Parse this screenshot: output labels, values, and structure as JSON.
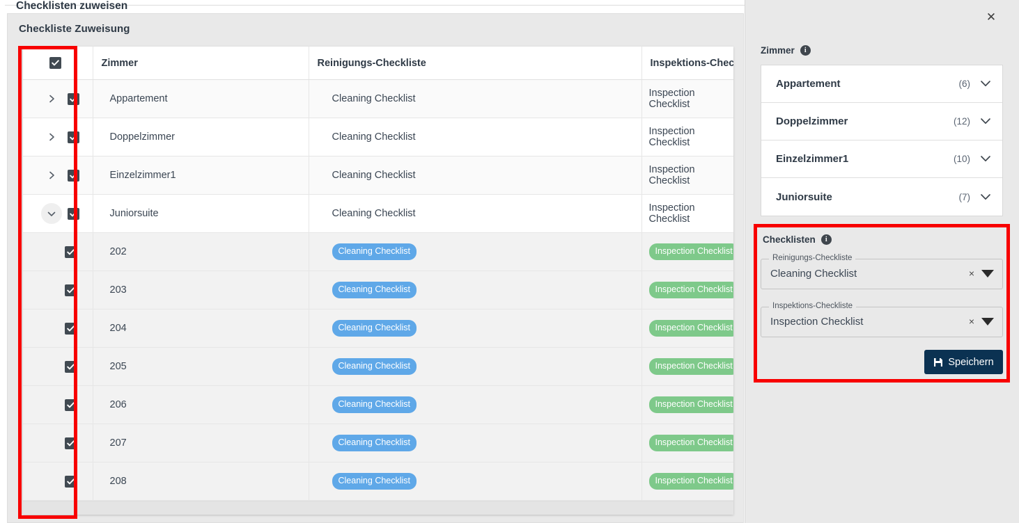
{
  "card": {
    "title": "Checkliste Zuweisung"
  },
  "table": {
    "headers": {
      "select": "",
      "room": "Zimmer",
      "cleaning": "Reinigungs-Checkliste",
      "inspection": "Inspektions-Checkliste"
    },
    "rows": [
      {
        "name": "Appartement",
        "cleaning": "Cleaning Checklist",
        "inspection": "Inspection Checklist",
        "type": "parent",
        "expanded": false,
        "checked": true,
        "stripe": "alt"
      },
      {
        "name": "Doppelzimmer",
        "cleaning": "Cleaning Checklist",
        "inspection": "Inspection Checklist",
        "type": "parent",
        "expanded": false,
        "checked": true,
        "stripe": "plain"
      },
      {
        "name": "Einzelzimmer1",
        "cleaning": "Cleaning Checklist",
        "inspection": "Inspection Checklist",
        "type": "parent",
        "expanded": false,
        "checked": true,
        "stripe": "alt"
      },
      {
        "name": "Juniorsuite",
        "cleaning": "Cleaning Checklist",
        "inspection": "Inspection Checklist",
        "type": "parent",
        "expanded": true,
        "checked": true,
        "stripe": "plain"
      },
      {
        "name": "202",
        "cleaning": "Cleaning Checklist",
        "inspection": "Inspection Checklist",
        "type": "child",
        "checked": true,
        "stripe": "child"
      },
      {
        "name": "203",
        "cleaning": "Cleaning Checklist",
        "inspection": "Inspection Checklist",
        "type": "child",
        "checked": true,
        "stripe": "child"
      },
      {
        "name": "204",
        "cleaning": "Cleaning Checklist",
        "inspection": "Inspection Checklist",
        "type": "child",
        "checked": true,
        "stripe": "child"
      },
      {
        "name": "205",
        "cleaning": "Cleaning Checklist",
        "inspection": "Inspection Checklist",
        "type": "child",
        "checked": true,
        "stripe": "child"
      },
      {
        "name": "206",
        "cleaning": "Cleaning Checklist",
        "inspection": "Inspection Checklist",
        "type": "child",
        "checked": true,
        "stripe": "child"
      },
      {
        "name": "207",
        "cleaning": "Cleaning Checklist",
        "inspection": "Inspection Checklist",
        "type": "child",
        "checked": true,
        "stripe": "child"
      },
      {
        "name": "208",
        "cleaning": "Cleaning Checklist",
        "inspection": "Inspection Checklist",
        "type": "child",
        "checked": true,
        "stripe": "child"
      }
    ],
    "select_all_checked": true
  },
  "panel": {
    "title": "Checklisten zuweisen",
    "close_icon": "✕",
    "zimmer": {
      "label": "Zimmer",
      "info_icon": "i",
      "items": [
        {
          "name": "Appartement",
          "count": "(6)"
        },
        {
          "name": "Doppelzimmer",
          "count": "(12)"
        },
        {
          "name": "Einzelzimmer1",
          "count": "(10)"
        },
        {
          "name": "Juniorsuite",
          "count": "(7)"
        }
      ]
    },
    "checklisten": {
      "label": "Checklisten",
      "info_icon": "i",
      "cleaning_field": {
        "legend": "Reinigungs-Checkliste",
        "value": "Cleaning Checklist",
        "clear_icon": "×"
      },
      "inspection_field": {
        "legend": "Inspektions-Checkliste",
        "value": "Inspection Checklist",
        "clear_icon": "×"
      },
      "save_label": "Speichern"
    }
  },
  "colors": {
    "badge_blue": "#5fa8e8",
    "badge_green": "#7ec98a",
    "save_button": "#0b3252",
    "annotation_red": "#f80000",
    "panel_bg": "#e9e9e9"
  }
}
